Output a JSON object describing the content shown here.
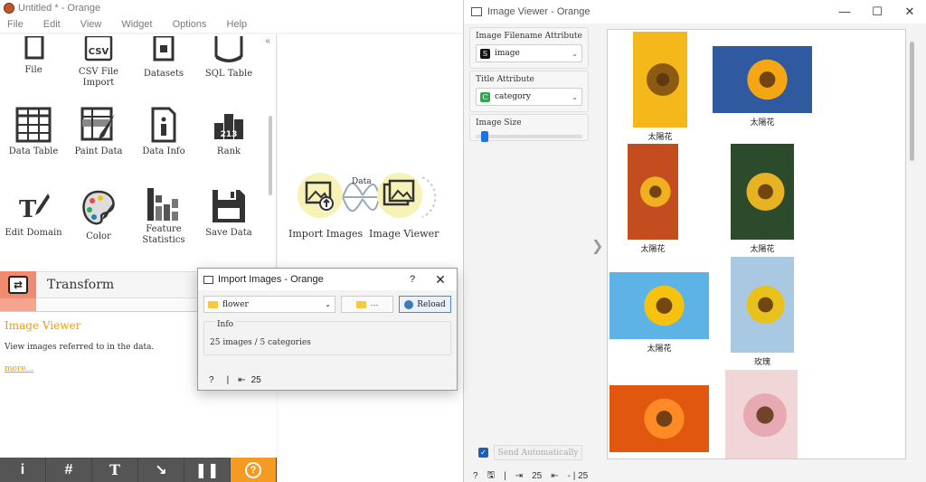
{
  "main_window": {
    "title": "Untitled * - Orange",
    "menu": [
      "File",
      "Edit",
      "View",
      "Widget",
      "Options",
      "Help"
    ]
  },
  "toolbox": {
    "widgets": [
      {
        "label": "File",
        "icon": "file-icon"
      },
      {
        "label": "CSV File Import",
        "icon": "csv-icon"
      },
      {
        "label": "Datasets",
        "icon": "datasets-icon"
      },
      {
        "label": "SQL Table",
        "icon": "sql-table-icon"
      },
      {
        "label": "Data Table",
        "icon": "data-table-icon"
      },
      {
        "label": "Paint Data",
        "icon": "paint-data-icon"
      },
      {
        "label": "Data Info",
        "icon": "data-info-icon"
      },
      {
        "label": "Rank",
        "icon": "rank-icon"
      },
      {
        "label": "Edit Domain",
        "icon": "edit-domain-icon"
      },
      {
        "label": "Color",
        "icon": "color-palette-icon"
      },
      {
        "label": "Feature Statistics",
        "icon": "feature-statistics-icon"
      },
      {
        "label": "Save Data",
        "icon": "save-data-icon"
      }
    ],
    "category": "Transform",
    "csv_glyph": "CSV",
    "rank_glyph": "213"
  },
  "description": {
    "title": "Image Viewer",
    "text": "View images referred to in the data.",
    "more": "more..."
  },
  "canvas": {
    "nodes": [
      {
        "label": "Import Images",
        "icon": "import-images-icon"
      },
      {
        "label": "Image Viewer",
        "icon": "image-viewer-icon"
      }
    ],
    "link_label": "Data"
  },
  "image_viewer": {
    "title": "Image Viewer - Orange",
    "filename_attr_label": "Image Filename Attribute",
    "filename_attr_value": "image",
    "filename_attr_badge": "S",
    "title_attr_label": "Title Attribute",
    "title_attr_value": "category",
    "title_attr_badge": "C",
    "image_size_label": "Image Size",
    "image_size_level": 0.05,
    "send_auto_label": "Send Automatically",
    "status_in": "25",
    "status_out": "- | 25",
    "thumbnails": [
      {
        "caption": "太陽花",
        "colors": [
          "#f5b81a",
          "#8a5b10"
        ]
      },
      {
        "caption": "太陽花",
        "colors": [
          "#2f5aa0",
          "#f5a614"
        ]
      },
      {
        "caption": "太陽花",
        "colors": [
          "#c44d1f",
          "#f0b020"
        ]
      },
      {
        "caption": "太陽花",
        "colors": [
          "#2c4a2c",
          "#e8b322"
        ]
      },
      {
        "caption": "太陽花",
        "colors": [
          "#5db3e6",
          "#f4c20f"
        ]
      },
      {
        "caption": "玫瑰",
        "colors": [
          "#a9c9e3",
          "#e9c11d"
        ]
      },
      {
        "caption": "",
        "colors": [
          "#e2570f",
          "#ff8a26"
        ]
      },
      {
        "caption": "",
        "colors": [
          "#f1d6d8",
          "#e7a9b2"
        ]
      }
    ]
  },
  "import_dialog": {
    "title": "Import Images - Orange",
    "help": "?",
    "directory": "flower",
    "browse_label": "···",
    "reload_label": "Reload",
    "info_label": "Info",
    "info_text": "25 images / 5 categories",
    "status_count": "25"
  },
  "colors": {
    "accent_orange": "#f29b05",
    "node_fill": "#f6f2b8",
    "selection_blue": "#1a73e8"
  }
}
